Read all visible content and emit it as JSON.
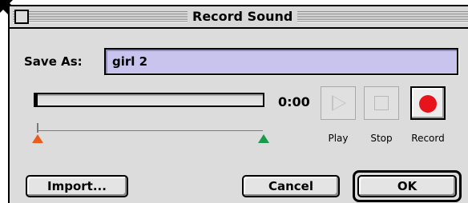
{
  "window": {
    "title": "Record Sound"
  },
  "save_as": {
    "label": "Save As:",
    "value": "girl 2"
  },
  "meter": {
    "level": 0.01,
    "time": "0:00"
  },
  "trim": {
    "start": 0.0,
    "end": 1.0
  },
  "transport": {
    "play": {
      "label": "Play",
      "enabled": false
    },
    "stop": {
      "label": "Stop",
      "enabled": false
    },
    "record": {
      "label": "Record",
      "enabled": true
    }
  },
  "buttons": {
    "import": "Import...",
    "cancel": "Cancel",
    "ok": "OK"
  },
  "colors": {
    "field_bg": "#c8c4ee",
    "record": "#e8141c",
    "trim_start": "#ee5a1c",
    "trim_end": "#1a9a4c"
  }
}
